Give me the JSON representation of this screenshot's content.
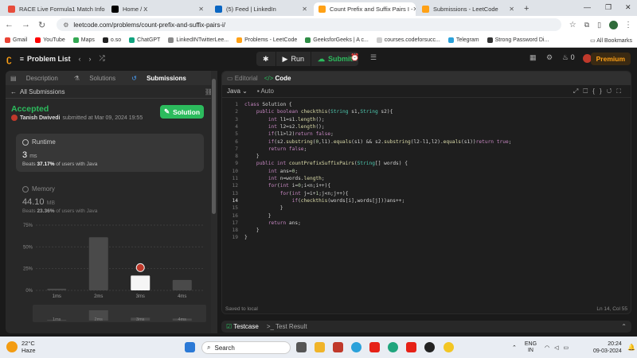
{
  "browser": {
    "tabs": [
      {
        "title": "RACE Live Formula1 Match Info",
        "color": "#e74c3c",
        "active": false
      },
      {
        "title": "Home / X",
        "color": "#000000",
        "active": false
      },
      {
        "title": "(5) Feed | LinkedIn",
        "color": "#0a66c2",
        "active": false
      },
      {
        "title": "Count Prefix and Suffix Pairs I -",
        "color": "#ffa116",
        "active": true
      },
      {
        "title": "Submissions - LeetCode",
        "color": "#ffa116",
        "active": false
      }
    ],
    "new_tab": "+",
    "url": "leetcode.com/problems/count-prefix-and-suffix-pairs-i/",
    "bookmarks": [
      {
        "label": "Gmail",
        "color": "#ea4335"
      },
      {
        "label": "YouTube",
        "color": "#ff0000"
      },
      {
        "label": "Maps",
        "color": "#34a853"
      },
      {
        "label": "o.so",
        "color": "#222222"
      },
      {
        "label": "ChatGPT",
        "color": "#10a37f"
      },
      {
        "label": "LinkedINTwitterLee...",
        "color": "#888888"
      },
      {
        "label": "Problems - LeetCode",
        "color": "#ffa116"
      },
      {
        "label": "GeeksforGeeks | A c...",
        "color": "#2f8d46"
      },
      {
        "label": "courses.codeforsucc...",
        "color": "#cccccc"
      },
      {
        "label": "Telegram",
        "color": "#2aa1da"
      },
      {
        "label": "Strong Password Di...",
        "color": "#333333"
      }
    ],
    "all_bookmarks": "All Bookmarks"
  },
  "lc_nav": {
    "problem_list": "Problem List",
    "run": "Run",
    "submit": "Submit",
    "streak": "0",
    "premium": "Premium"
  },
  "left": {
    "tabs": [
      "Description",
      "Solutions",
      "Submissions"
    ],
    "all_submissions": "All Submissions",
    "status": "Accepted",
    "author": "Tanish Dwivedi",
    "submitted": "submitted at Mar 09, 2024 19:55",
    "solution_btn": "Solution",
    "runtime": {
      "label": "Runtime",
      "value": "3",
      "unit": "ms",
      "beats_prefix": "Beats",
      "beats": "37.17%",
      "beats_suffix": "of users with Java"
    },
    "memory": {
      "label": "Memory",
      "value": "44.10",
      "unit": "MB",
      "beats_prefix": "Beats",
      "beats": "23.36%",
      "beats_suffix": "of users with Java"
    }
  },
  "chart_data": {
    "type": "bar",
    "categories": [
      "1ms",
      "2ms",
      "3ms",
      "4ms"
    ],
    "values": [
      2,
      61,
      17,
      12
    ],
    "highlight": "3ms",
    "yticks": [
      "0%",
      "25%",
      "50%",
      "75%"
    ],
    "ylim": [
      0,
      75
    ],
    "xlabel": "",
    "ylabel": ""
  },
  "editor": {
    "tabs": [
      "Editorial",
      "Code"
    ],
    "language": "Java",
    "mode": "Auto",
    "cursor_line": 14,
    "code": [
      "class Solution {",
      "    public boolean checkthis(String s1,String s2){",
      "        int l1=s1.length();",
      "        int l2=s2.length();",
      "        if(l1>l2)return false;",
      "        if(s2.substring(0,l1).equals(s1) && s2.substring(l2-l1,l2).equals(s1))return true;",
      "        return false;",
      "    }",
      "    public int countPrefixSuffixPairs(String[] words) {",
      "        int ans=0;",
      "        int n=words.length;",
      "        for(int i=0;i<n;i++){",
      "            for(int j=i+1;j<n;j++){",
      "                if(checkthis(words[i],words[j]))ans++;",
      "            }",
      "        }",
      "        return ans;",
      "    }",
      "}"
    ],
    "saved": "Saved to local",
    "position": "Ln 14, Col 55"
  },
  "bottom": {
    "testcase": "Testcase",
    "result": "Test Result"
  },
  "taskbar": {
    "temp": "22°C",
    "weather": "Haze",
    "search": "Search",
    "lang1": "ENG",
    "lang2": "IN",
    "time": "20:24",
    "date": "09-03-2024"
  }
}
